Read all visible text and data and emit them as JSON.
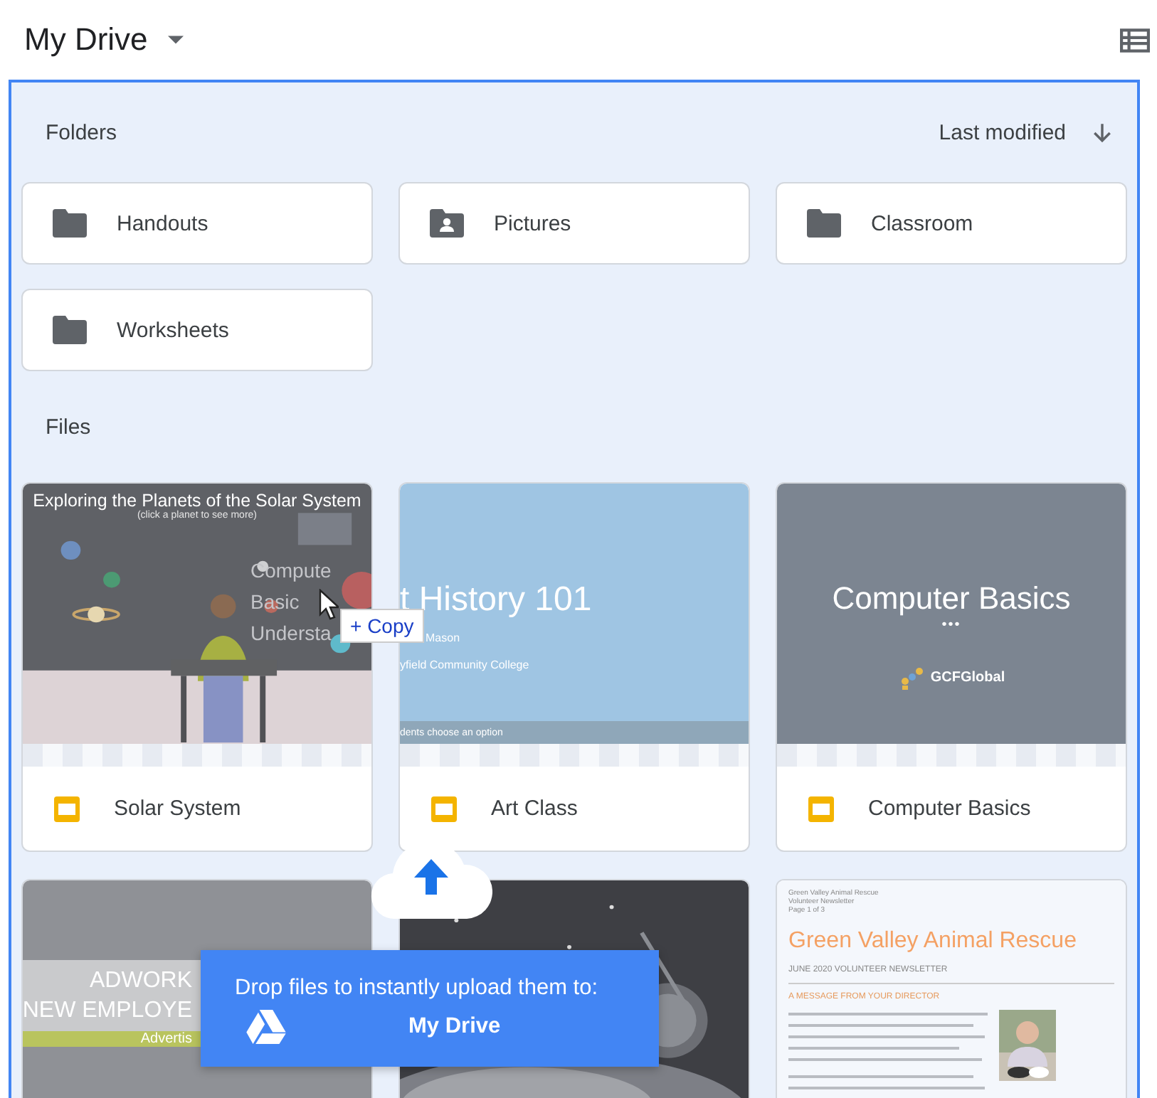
{
  "header": {
    "title": "My Drive"
  },
  "folders_section": {
    "label": "Folders",
    "sort": "Last modified"
  },
  "folders": [
    {
      "name": "Handouts",
      "kind": "plain"
    },
    {
      "name": "Pictures",
      "kind": "shared"
    },
    {
      "name": "Classroom",
      "kind": "plain"
    },
    {
      "name": "Worksheets",
      "kind": "plain"
    }
  ],
  "files_section": {
    "label": "Files"
  },
  "files": [
    {
      "name": "Solar System",
      "kind": "slides",
      "thumb": {
        "kind": "solar",
        "title": "Exploring the Planets of the Solar System",
        "subtitle": "(click a planet to see more)",
        "ghost": [
          "Compute",
          "Basic",
          "Understa"
        ]
      }
    },
    {
      "name": "Art Class",
      "kind": "slides",
      "thumb": {
        "kind": "title",
        "title": "t History 101",
        "lines": [
          "Mason",
          "yfield Community College"
        ],
        "footer": "dents choose an option"
      }
    },
    {
      "name": "Computer Basics",
      "kind": "slides",
      "thumb": {
        "kind": "basics",
        "title": "Computer Basics",
        "dots": "•••",
        "logo": "GCFGlobal"
      }
    },
    {
      "thumb": {
        "kind": "adwork",
        "lines": [
          "ADWORK",
          "NEW EMPLOYE"
        ],
        "band": "Advertis"
      }
    },
    {
      "thumb": {
        "kind": "space"
      }
    },
    {
      "thumb": {
        "kind": "newsletter",
        "meta": [
          "Green Valley Animal Rescue",
          "Volunteer Newsletter",
          "Page 1 of 3"
        ],
        "title": "Green Valley Animal Rescue",
        "subtitle": "JUNE 2020 VOLUNTEER NEWSLETTER",
        "section": "A MESSAGE FROM YOUR DIRECTOR"
      }
    }
  ],
  "drag": {
    "label": "+ Copy"
  },
  "upload_toast": {
    "message": "Drop files to instantly upload them to:",
    "destination": "My Drive"
  }
}
